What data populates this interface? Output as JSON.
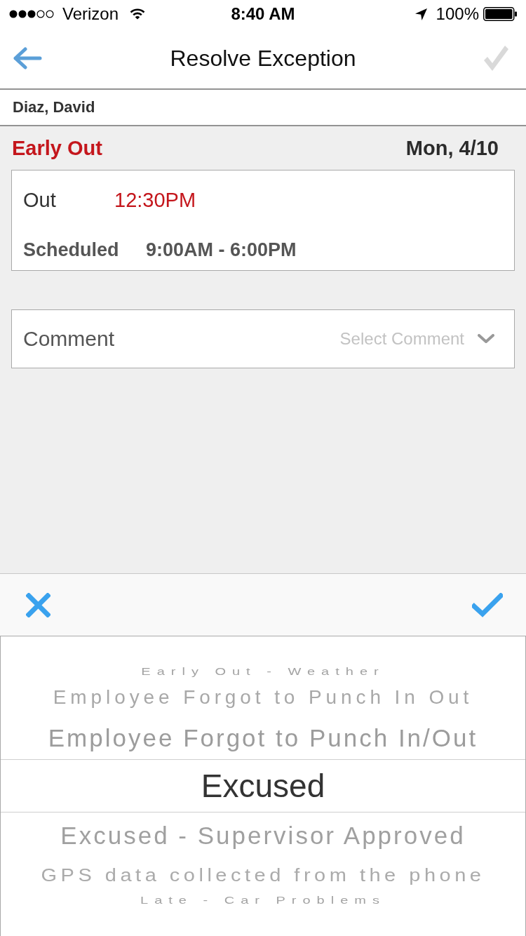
{
  "status_bar": {
    "carrier": "Verizon",
    "time": "8:40 AM",
    "battery": "100%"
  },
  "nav": {
    "title": "Resolve Exception",
    "confirm_disabled": true
  },
  "employee": {
    "name": "Diaz, David"
  },
  "exception": {
    "type": "Early Out",
    "date": "Mon, 4/10"
  },
  "punch": {
    "rows": [
      {
        "kind": "alert",
        "label": "Out",
        "value": "12:30PM"
      },
      {
        "kind": "schedule",
        "label": "Scheduled",
        "value": "9:00AM - 6:00PM"
      }
    ]
  },
  "comment": {
    "label": "Comment",
    "placeholder": "Select Comment"
  },
  "picker": {
    "options": [
      {
        "label": "Early Out - Weather",
        "selected": false
      },
      {
        "label": "Employee Forgot to Punch In Out",
        "selected": false
      },
      {
        "label": "Employee Forgot to Punch In/Out",
        "selected": false
      },
      {
        "label": "Excused",
        "selected": true
      },
      {
        "label": "Excused - Supervisor Approved",
        "selected": false
      },
      {
        "label": "GPS data collected from the phone",
        "selected": false
      },
      {
        "label": "Late - Car Problems",
        "selected": false
      }
    ]
  }
}
